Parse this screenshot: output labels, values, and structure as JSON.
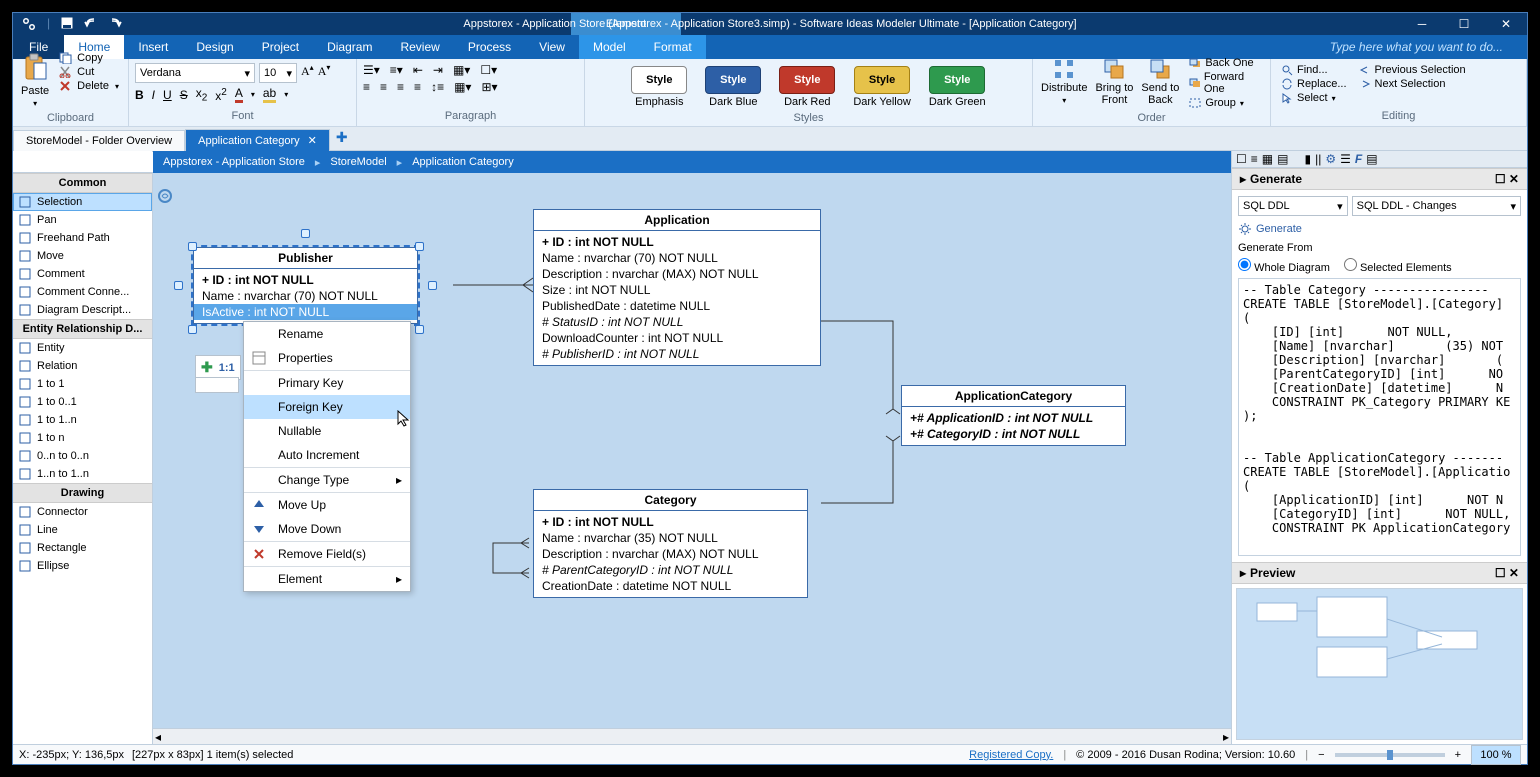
{
  "titlebar": {
    "context_tab": "Element",
    "title": "Appstorex - Application Store (Appstorex - Application Store3.simp)  - Software Ideas Modeler Ultimate - [Application Category]"
  },
  "ribbon_tabs": {
    "file": "File",
    "items": [
      "Home",
      "Insert",
      "Design",
      "Project",
      "Diagram",
      "Review",
      "Process",
      "View",
      "Model",
      "Format"
    ],
    "search_placeholder": "Type here what you want to do..."
  },
  "ribbon": {
    "clipboard": {
      "paste": "Paste",
      "copy": "Copy",
      "cut": "Cut",
      "delete": "Delete",
      "label": "Clipboard"
    },
    "font": {
      "family": "Verdana",
      "size": "10",
      "label": "Font"
    },
    "paragraph": {
      "label": "Paragraph"
    },
    "styles": {
      "label": "Styles",
      "items": [
        {
          "name": "Emphasis",
          "bg": "#ffffff",
          "fg": "#000",
          "border": "#888"
        },
        {
          "name": "Dark Blue",
          "bg": "#2d5fa6",
          "fg": "#fff",
          "border": "#1e4175"
        },
        {
          "name": "Dark Red",
          "bg": "#c0392b",
          "fg": "#fff",
          "border": "#7a1f15"
        },
        {
          "name": "Dark Yellow",
          "bg": "#e6c24a",
          "fg": "#000",
          "border": "#a48116"
        },
        {
          "name": "Dark Green",
          "bg": "#2e9a4e",
          "fg": "#fff",
          "border": "#1d6a33"
        }
      ],
      "style_label": "Style"
    },
    "order": {
      "distribute": "Distribute",
      "btf": "Bring to\nFront",
      "stb": "Send to\nBack",
      "back_one": "Back One",
      "forward_one": "Forward One",
      "group": "Group",
      "label": "Order"
    },
    "editing": {
      "find": "Find...",
      "replace": "Replace...",
      "select": "Select",
      "prev": "Previous Selection",
      "next": "Next Selection",
      "label": "Editing"
    }
  },
  "doc_tabs": {
    "overview": "StoreModel - Folder Overview",
    "active": "Application Category"
  },
  "breadcrumb": [
    "Appstorex - Application Store",
    "StoreModel",
    "Application Category"
  ],
  "toolbox": {
    "common_head": "Common",
    "common": [
      "Selection",
      "Pan",
      "Freehand Path",
      "Move",
      "Comment",
      "Comment Conne...",
      "Diagram Descript..."
    ],
    "erd_head": "Entity Relationship D...",
    "erd": [
      "Entity",
      "Relation",
      "1 to 1",
      "1 to 0..1",
      "1 to 1..n",
      "1 to n",
      "0..n to 0..n",
      "1..n to 1..n"
    ],
    "drawing_head": "Drawing",
    "drawing": [
      "Connector",
      "Line",
      "Rectangle",
      "Ellipse"
    ]
  },
  "entities": {
    "publisher": {
      "title": "Publisher",
      "rows": [
        "+ ID : int NOT NULL",
        "Name : nvarchar (70)  NOT NULL",
        "IsActive : int NOT NULL"
      ]
    },
    "application": {
      "title": "Application",
      "rows": [
        "+ ID : int NOT NULL",
        "Name : nvarchar (70)  NOT NULL",
        "Description : nvarchar (MAX)  NOT NULL",
        "Size : int NOT NULL",
        "PublishedDate : datetime NULL",
        "# StatusID : int NOT NULL",
        "DownloadCounter : int NOT NULL",
        "# PublisherID : int NOT NULL"
      ]
    },
    "appcat": {
      "title": "ApplicationCategory",
      "rows": [
        "+# ApplicationID : int NOT NULL",
        "+# CategoryID : int NOT NULL"
      ]
    },
    "category": {
      "title": "Category",
      "rows": [
        "+ ID : int NOT NULL",
        "Name : nvarchar (35)  NOT NULL",
        "Description : nvarchar (MAX)  NOT NULL",
        "# ParentCategoryID : int NOT NULL",
        "CreationDate : datetime NOT NULL"
      ]
    }
  },
  "float_label": "1:1",
  "context_menu": {
    "items": [
      {
        "l": "Rename"
      },
      {
        "l": "Properties",
        "icon": "props"
      },
      {
        "l": "Primary Key",
        "sep": true
      },
      {
        "l": "Foreign Key",
        "hover": true
      },
      {
        "l": "Nullable"
      },
      {
        "l": "Auto Increment"
      },
      {
        "l": "Change Type",
        "sep": true,
        "sub": true
      },
      {
        "l": "Move Up",
        "sep": true,
        "icon": "up"
      },
      {
        "l": "Move Down",
        "icon": "down"
      },
      {
        "l": "Remove Field(s)",
        "sep": true,
        "icon": "del"
      },
      {
        "l": "Element",
        "sep": true,
        "sub": true
      }
    ]
  },
  "rightpane": {
    "generate_head": "Generate",
    "format1": "SQL DDL",
    "format2": "SQL DDL - Changes",
    "generate_btn": "Generate",
    "generate_from": "Generate From",
    "whole": "Whole Diagram",
    "selected": "Selected Elements",
    "sql": "-- Table Category ----------------\nCREATE TABLE [StoreModel].[Category]\n(\n    [ID] [int]      NOT NULL,\n    [Name] [nvarchar]       (35) NOT\n    [Description] [nvarchar]       (\n    [ParentCategoryID] [int]      NO\n    [CreationDate] [datetime]      N\n    CONSTRAINT PK_Category PRIMARY KE\n);\n\n\n-- Table ApplicationCategory -------\nCREATE TABLE [StoreModel].[Applicatio\n(\n    [ApplicationID] [int]      NOT N\n    [CategoryID] [int]      NOT NULL,\n    CONSTRAINT PK ApplicationCategory",
    "preview_head": "Preview"
  },
  "status": {
    "coords": "X: -235px; Y: 136,5px",
    "sel": "[227px x 83px] 1 item(s) selected",
    "registered": "Registered Copy.",
    "copyright": "© 2009 - 2016 Dusan Rodina; Version: 10.60",
    "zoom": "100 %"
  }
}
